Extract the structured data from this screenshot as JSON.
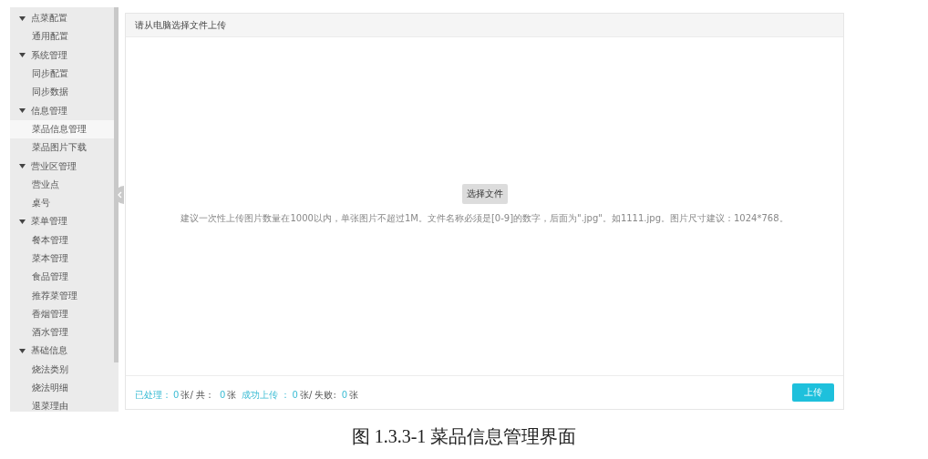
{
  "sidebar": {
    "groups": [
      {
        "label": "点菜配置",
        "expanded": true,
        "items": [
          {
            "label": "通用配置",
            "selected": false
          }
        ]
      },
      {
        "label": "系统管理",
        "expanded": true,
        "items": [
          {
            "label": "同步配置",
            "selected": false
          },
          {
            "label": "同步数据",
            "selected": false
          }
        ]
      },
      {
        "label": "信息管理",
        "expanded": true,
        "items": [
          {
            "label": "菜品信息管理",
            "selected": true
          },
          {
            "label": "菜品图片下载",
            "selected": false
          }
        ]
      },
      {
        "label": "营业区管理",
        "expanded": true,
        "items": [
          {
            "label": "营业点",
            "selected": false
          },
          {
            "label": "桌号",
            "selected": false
          }
        ]
      },
      {
        "label": "菜单管理",
        "expanded": true,
        "items": [
          {
            "label": "餐本管理",
            "selected": false
          },
          {
            "label": "菜本管理",
            "selected": false
          },
          {
            "label": "食品管理",
            "selected": false
          },
          {
            "label": "推荐菜管理",
            "selected": false
          },
          {
            "label": "香烟管理",
            "selected": false
          },
          {
            "label": "酒水管理",
            "selected": false
          }
        ]
      },
      {
        "label": "基础信息",
        "expanded": true,
        "items": [
          {
            "label": "烧法类别",
            "selected": false
          },
          {
            "label": "烧法明细",
            "selected": false
          },
          {
            "label": "退菜理由",
            "selected": false
          }
        ]
      }
    ]
  },
  "panel": {
    "title": "请从电脑选择文件上传",
    "choose_button": "选择文件",
    "hint": "建议一次性上传图片数量在1000以内，单张图片不超过1M。文件名称必须是[0-9]的数字，后面为\".jpg\"。如1111.jpg。图片尺寸建议：1024*768。",
    "status": [
      {
        "kind": "label",
        "text": "已处理："
      },
      {
        "kind": "count",
        "text": "0"
      },
      {
        "kind": "text",
        "text": "张/ 共："
      },
      {
        "kind": "count",
        "text": "0"
      },
      {
        "kind": "text",
        "text": "张"
      },
      {
        "kind": "label",
        "text": "成功上传 ："
      },
      {
        "kind": "count",
        "text": "0"
      },
      {
        "kind": "text",
        "text": "张/ 失败:"
      },
      {
        "kind": "count",
        "text": "0"
      },
      {
        "kind": "text",
        "text": "张"
      }
    ],
    "upload_button": "上传"
  },
  "caption": "图 1.3.3-1  菜品信息管理界面"
}
